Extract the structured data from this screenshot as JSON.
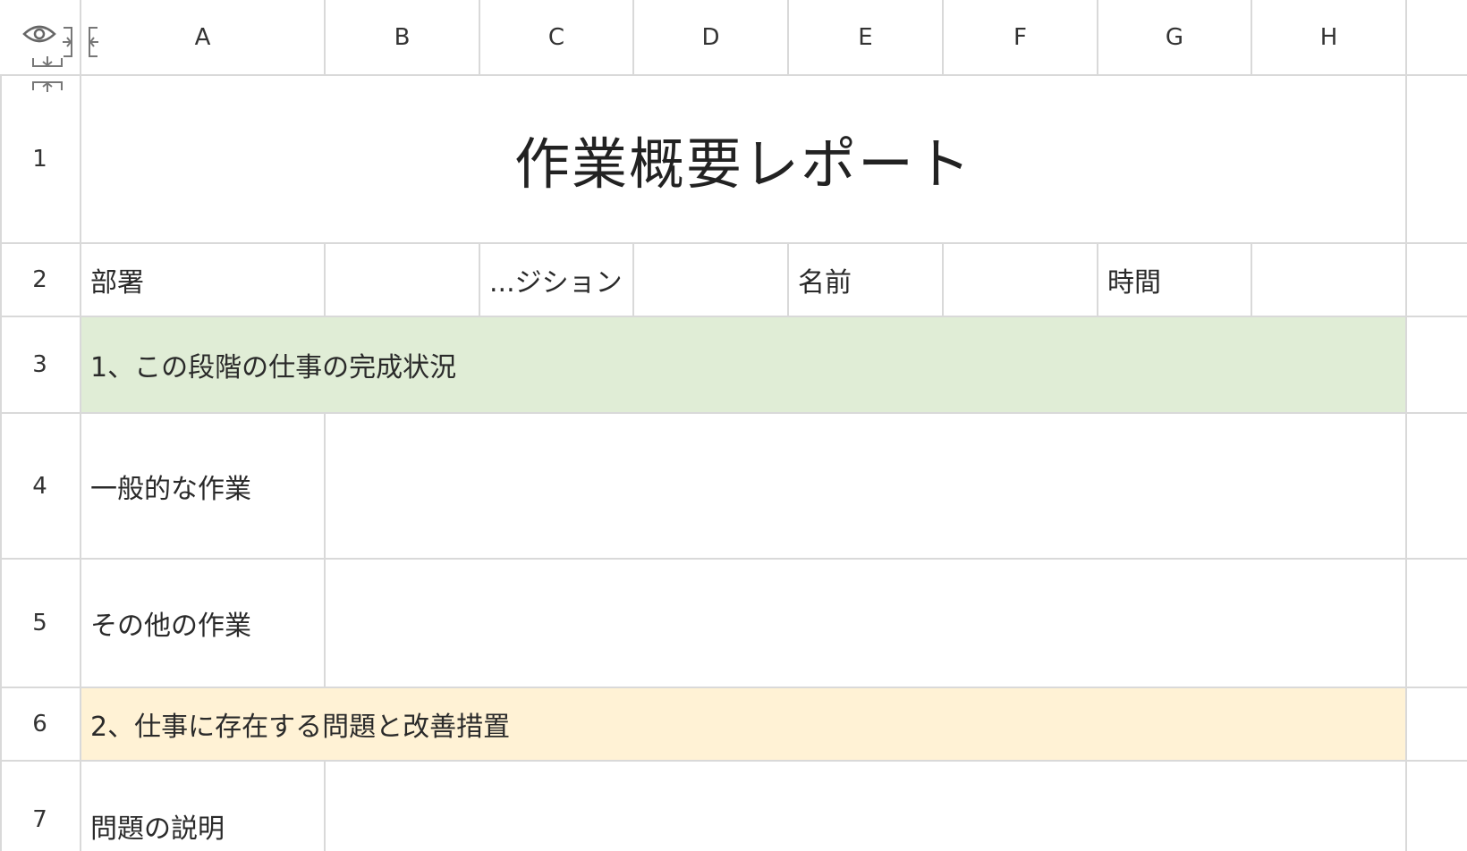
{
  "columns": [
    "A",
    "B",
    "C",
    "D",
    "E",
    "F",
    "G",
    "H"
  ],
  "rows": [
    "1",
    "2",
    "3",
    "4",
    "5",
    "6",
    "7"
  ],
  "cells": {
    "title": "作業概要レポート",
    "dept_label": "部署",
    "position_label": "...ジション",
    "name_label": "名前",
    "time_label": "時間",
    "section1": "1、この段階の仕事の完成状況",
    "general_work": "一般的な作業",
    "other_work": "その他の作業",
    "section2": "2、仕事に存在する問題と改善措置",
    "problem_desc": "問題の説明"
  },
  "colors": {
    "section1_fill": "#e0edd6",
    "section2_fill": "#fff2d5",
    "grid": "#d9d9d9"
  },
  "icons": [
    "eye-icon",
    "collapse-columns-icon",
    "collapse-rows-icon"
  ]
}
